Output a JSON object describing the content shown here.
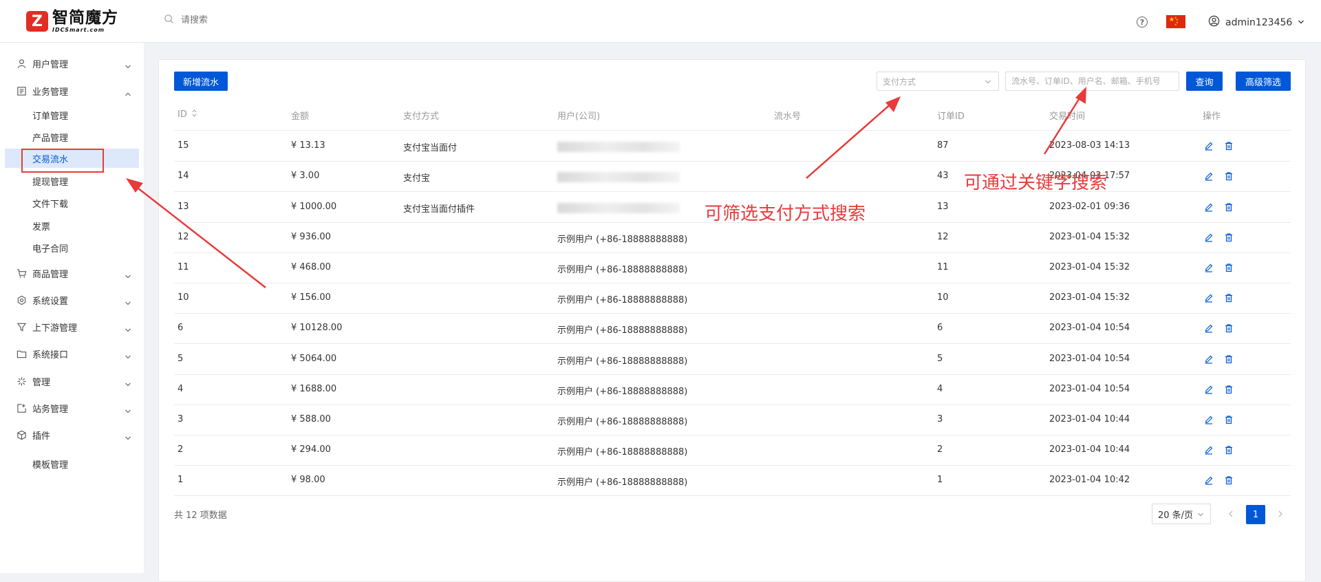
{
  "header": {
    "logo_cn": "智简魔方",
    "logo_en": "IDCSmart.com",
    "search_placeholder": "请搜索",
    "user_name": "admin123456"
  },
  "sidebar": {
    "groups": [
      {
        "label": "用户管理",
        "icon": "user-icon"
      },
      {
        "label": "业务管理",
        "icon": "list-icon",
        "expanded": true
      },
      {
        "label": "商品管理",
        "icon": "cart-icon"
      },
      {
        "label": "系统设置",
        "icon": "settings-icon"
      },
      {
        "label": "上下游管理",
        "icon": "filter-icon"
      },
      {
        "label": "系统接口",
        "icon": "folder-icon"
      },
      {
        "label": "管理",
        "icon": "asterisk-icon"
      },
      {
        "label": "站务管理",
        "icon": "site-icon"
      },
      {
        "label": "插件",
        "icon": "cube-icon"
      }
    ],
    "sub_items": [
      "订单管理",
      "产品管理",
      "交易流水",
      "提现管理",
      "文件下载",
      "发票",
      "电子合同"
    ],
    "extra_item": "模板管理",
    "active_sub": "交易流水"
  },
  "toolbar": {
    "add_button": "新增流水",
    "pay_select_placeholder": "支付方式",
    "keyword_placeholder": "流水号、订单ID、用户名、邮箱、手机号",
    "query_button": "查询",
    "advanced_button": "高级筛选"
  },
  "table": {
    "headers": [
      "ID",
      "金额",
      "支付方式",
      "用户(公司)",
      "流水号",
      "订单ID",
      "交易时间",
      "操作"
    ],
    "rows": [
      {
        "id": "15",
        "amount": "¥ 13.13",
        "pay": "支付宝当面付",
        "user": "",
        "serial": "",
        "order": "87",
        "time": "2023-08-03 14:13",
        "user_blurred": true
      },
      {
        "id": "14",
        "amount": "¥ 3.00",
        "pay": "支付宝",
        "user": "",
        "serial": "",
        "order": "43",
        "time": "2023-04-03 17:57",
        "user_blurred": true
      },
      {
        "id": "13",
        "amount": "¥ 1000.00",
        "pay": "支付宝当面付插件",
        "user": "",
        "serial": "",
        "order": "13",
        "time": "2023-02-01 09:36",
        "user_blurred": true
      },
      {
        "id": "12",
        "amount": "¥ 936.00",
        "pay": "",
        "user": "示例用户 (+86-18888888888)",
        "serial": "",
        "order": "12",
        "time": "2023-01-04 15:32"
      },
      {
        "id": "11",
        "amount": "¥ 468.00",
        "pay": "",
        "user": "示例用户 (+86-18888888888)",
        "serial": "",
        "order": "11",
        "time": "2023-01-04 15:32"
      },
      {
        "id": "10",
        "amount": "¥ 156.00",
        "pay": "",
        "user": "示例用户 (+86-18888888888)",
        "serial": "",
        "order": "10",
        "time": "2023-01-04 15:32"
      },
      {
        "id": "6",
        "amount": "¥ 10128.00",
        "pay": "",
        "user": "示例用户 (+86-18888888888)",
        "serial": "",
        "order": "6",
        "time": "2023-01-04 10:54"
      },
      {
        "id": "5",
        "amount": "¥ 5064.00",
        "pay": "",
        "user": "示例用户 (+86-18888888888)",
        "serial": "",
        "order": "5",
        "time": "2023-01-04 10:54"
      },
      {
        "id": "4",
        "amount": "¥ 1688.00",
        "pay": "",
        "user": "示例用户 (+86-18888888888)",
        "serial": "",
        "order": "4",
        "time": "2023-01-04 10:54"
      },
      {
        "id": "3",
        "amount": "¥ 588.00",
        "pay": "",
        "user": "示例用户 (+86-18888888888)",
        "serial": "",
        "order": "3",
        "time": "2023-01-04 10:44"
      },
      {
        "id": "2",
        "amount": "¥ 294.00",
        "pay": "",
        "user": "示例用户 (+86-18888888888)",
        "serial": "",
        "order": "2",
        "time": "2023-01-04 10:44"
      },
      {
        "id": "1",
        "amount": "¥ 98.00",
        "pay": "",
        "user": "示例用户 (+86-18888888888)",
        "serial": "",
        "order": "1",
        "time": "2023-01-04 10:42"
      }
    ]
  },
  "pagination": {
    "total_text": "共 12 项数据",
    "page_size": "20 条/页",
    "current_page": "1"
  },
  "annotations": {
    "pay_filter": "可筛选支付方式搜索",
    "keyword_search": "可通过关键字搜索"
  },
  "colors": {
    "primary": "#0058d8",
    "annotation": "#e83a3a",
    "active_bg": "#dde9fb"
  }
}
